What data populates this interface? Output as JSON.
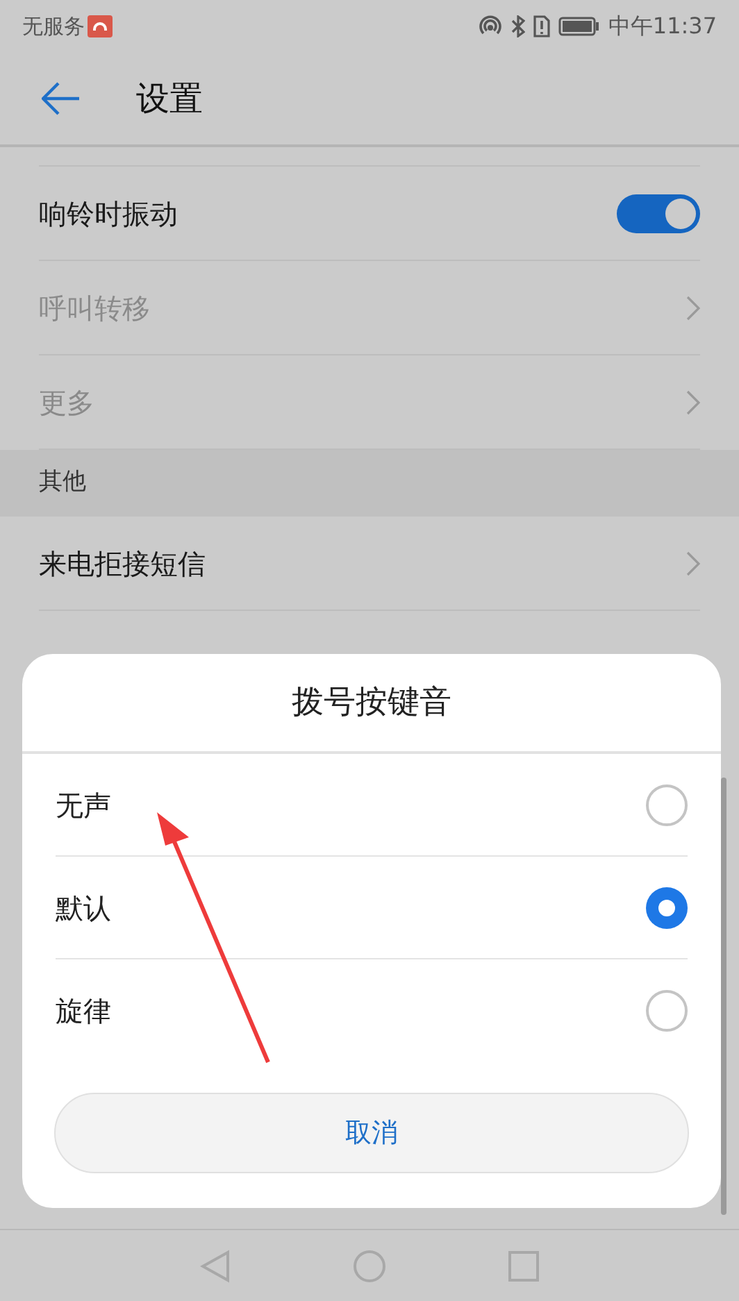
{
  "status_bar": {
    "carrier": "无服务",
    "time": "中午11:37"
  },
  "header": {
    "title": "设置"
  },
  "settings": [
    {
      "kind": "toggle",
      "label": "响铃时振动",
      "on": true,
      "disabled": false
    },
    {
      "kind": "link",
      "label": "呼叫转移",
      "disabled": true
    },
    {
      "kind": "link",
      "label": "更多",
      "disabled": true
    },
    {
      "kind": "section",
      "label": "其他"
    },
    {
      "kind": "link",
      "label": "来电拒接短信",
      "disabled": false
    }
  ],
  "dialog": {
    "title": "拨号按键音",
    "options": [
      {
        "label": "无声",
        "selected": false
      },
      {
        "label": "默认",
        "selected": true
      },
      {
        "label": "旋律",
        "selected": false
      }
    ],
    "cancel": "取消"
  }
}
